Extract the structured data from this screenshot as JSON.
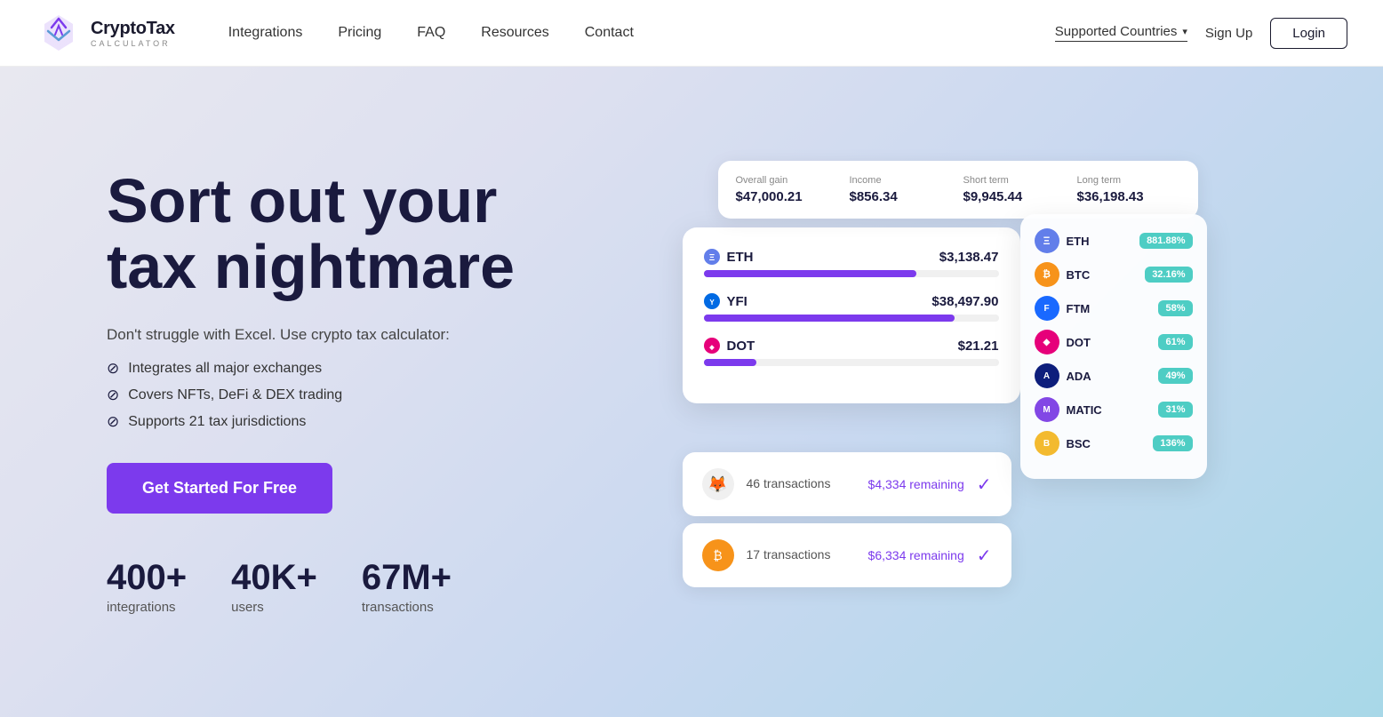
{
  "nav": {
    "logo_main": "CryptoTax",
    "logo_sub": "CALCULATOR",
    "links": [
      {
        "label": "Integrations",
        "id": "integrations"
      },
      {
        "label": "Pricing",
        "id": "pricing"
      },
      {
        "label": "FAQ",
        "id": "faq"
      },
      {
        "label": "Resources",
        "id": "resources"
      },
      {
        "label": "Contact",
        "id": "contact"
      }
    ],
    "supported_countries": "Supported Countries",
    "signup": "Sign Up",
    "login": "Login"
  },
  "hero": {
    "title_line1": "Sort out your",
    "title_line2": "tax nightmare",
    "subtitle": "Don't struggle with Excel. Use crypto tax calculator:",
    "features": [
      "Integrates all major exchanges",
      "Covers NFTs, DeFi & DEX trading",
      "Supports 21 tax jurisdictions"
    ],
    "cta": "Get Started For Free",
    "stats": [
      {
        "num": "400+",
        "label": "integrations"
      },
      {
        "num": "40K+",
        "label": "users"
      },
      {
        "num": "67M+",
        "label": "transactions"
      }
    ]
  },
  "dashboard": {
    "stats_bar": [
      {
        "label": "Overall gain",
        "value": "$47,000.21"
      },
      {
        "label": "Income",
        "value": "$856.34"
      },
      {
        "label": "Short term",
        "value": "$9,945.44"
      },
      {
        "label": "Long term",
        "value": "$36,198.43"
      }
    ],
    "coins": [
      {
        "name": "ETH",
        "value": "$3,138.47",
        "bar_width": "72%"
      },
      {
        "name": "YFI",
        "value": "$38,497.90",
        "bar_width": "85%"
      },
      {
        "name": "DOT",
        "value": "$21.21",
        "bar_width": "18%"
      }
    ],
    "transactions": [
      {
        "icon": "🦊",
        "count": "46 transactions",
        "remaining": "$4,334 remaining"
      },
      {
        "icon": "₿",
        "count": "17 transactions",
        "remaining": "$6,334 remaining"
      }
    ],
    "gains": [
      {
        "symbol": "ETH",
        "icon_type": "eth",
        "value": "881.88%"
      },
      {
        "symbol": "BTC",
        "icon_type": "btc",
        "value": "32.16%"
      },
      {
        "symbol": "FTM",
        "icon_type": "ftm",
        "value": "58%"
      },
      {
        "symbol": "DOT",
        "icon_type": "dot",
        "value": "61%"
      },
      {
        "symbol": "ADA",
        "icon_type": "ada",
        "value": "49%"
      },
      {
        "symbol": "MATIC",
        "icon_type": "matic",
        "value": "31%"
      },
      {
        "symbol": "BSC",
        "icon_type": "bsc",
        "value": "136%"
      }
    ]
  }
}
